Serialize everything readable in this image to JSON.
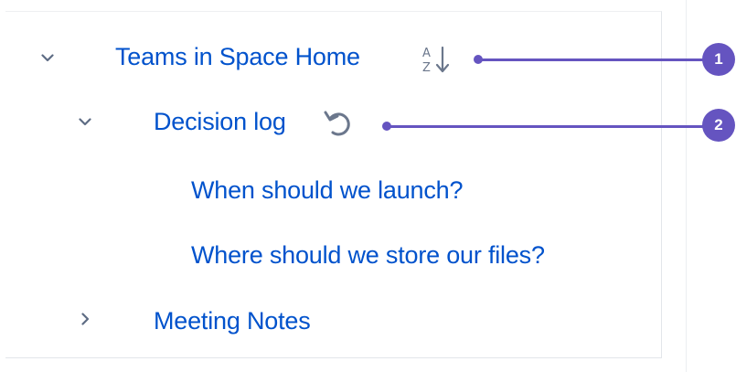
{
  "tree": {
    "root": {
      "label": "Teams in Space Home",
      "expanded": true
    },
    "decision_log": {
      "label": "Decision log",
      "expanded": true
    },
    "child_1": {
      "label": "When should we launch?"
    },
    "child_2": {
      "label": "Where should we store our files?"
    },
    "meeting_notes": {
      "label": "Meeting Notes",
      "expanded": false
    }
  },
  "icons": {
    "sort": "sort-alphabetical-icon",
    "undo": "undo-icon"
  },
  "callouts": [
    {
      "number": "1"
    },
    {
      "number": "2"
    }
  ],
  "colors": {
    "link": "#0052cc",
    "callout": "#6554c0",
    "chevron": "#5e6c84",
    "icon": "#6b778c"
  }
}
